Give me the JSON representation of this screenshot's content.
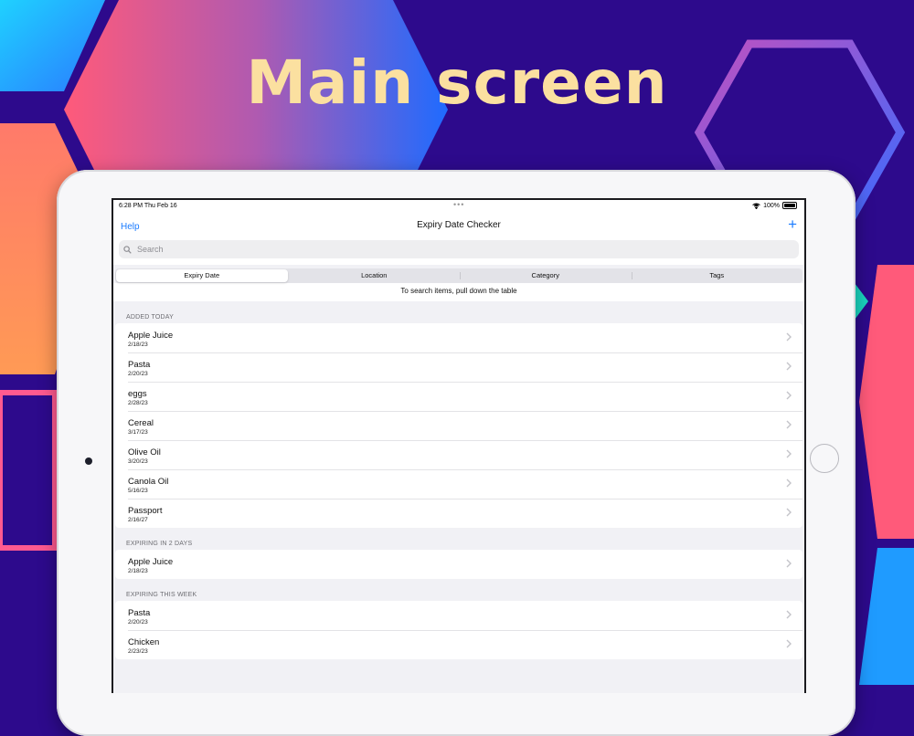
{
  "headline": "Main screen",
  "status_bar": {
    "time": "6:28 PM  Thu Feb 16",
    "battery": "100%"
  },
  "nav": {
    "help_label": "Help",
    "title": "Expiry Date Checker",
    "add_label": "+"
  },
  "search": {
    "placeholder": "Search"
  },
  "segments": [
    "Expiry Date",
    "Location",
    "Category",
    "Tags"
  ],
  "hint": "To search items, pull down the table",
  "sections": [
    {
      "header": "ADDED TODAY",
      "items": [
        {
          "name": "Apple Juice",
          "date": "2/18/23"
        },
        {
          "name": "Pasta",
          "date": "2/20/23"
        },
        {
          "name": "eggs",
          "date": "2/28/23"
        },
        {
          "name": "Cereal",
          "date": "3/17/23"
        },
        {
          "name": "Olive Oil",
          "date": "3/20/23"
        },
        {
          "name": "Canola Oil",
          "date": "5/16/23"
        },
        {
          "name": "Passport",
          "date": "2/16/27"
        }
      ]
    },
    {
      "header": "EXPIRING IN 2 DAYS",
      "items": [
        {
          "name": "Apple Juice",
          "date": "2/18/23"
        }
      ]
    },
    {
      "header": "EXPIRING THIS WEEK",
      "items": [
        {
          "name": "Pasta",
          "date": "2/20/23"
        },
        {
          "name": "Chicken",
          "date": "2/23/23"
        }
      ]
    }
  ],
  "colors": {
    "background": "#2d0a8c",
    "headline": "#fbe0a0",
    "accent": "#1a7bff"
  }
}
